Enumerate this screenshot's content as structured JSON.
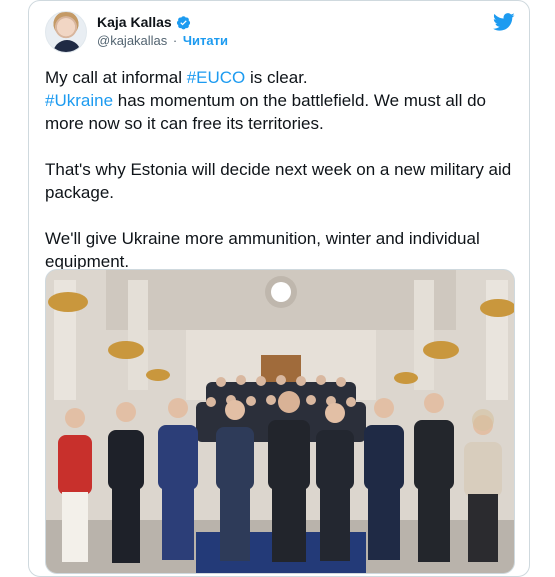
{
  "author": {
    "name": "Kaja Kallas",
    "handle": "@kajakallas",
    "separator": "·",
    "follow_label": "Читати"
  },
  "icons": {
    "verified": "verified-badge-icon",
    "logo": "twitter-bird-icon"
  },
  "colors": {
    "accent": "#1d9bf0",
    "text": "#0f1419",
    "muted": "#536471"
  },
  "tweet": {
    "p1_before": "My call at informal ",
    "p1_tag1": "#EUCO",
    "p1_after": " is clear.",
    "p1_tag2": "#Ukraine",
    "p1_rest": " has momentum on the battlefield. We must all do more now so it can free its territories.",
    "p2": "That's why Estonia will decide next week on a new military aid package.",
    "p3": "We'll give Ukraine more ammunition, winter and individual equipment."
  }
}
